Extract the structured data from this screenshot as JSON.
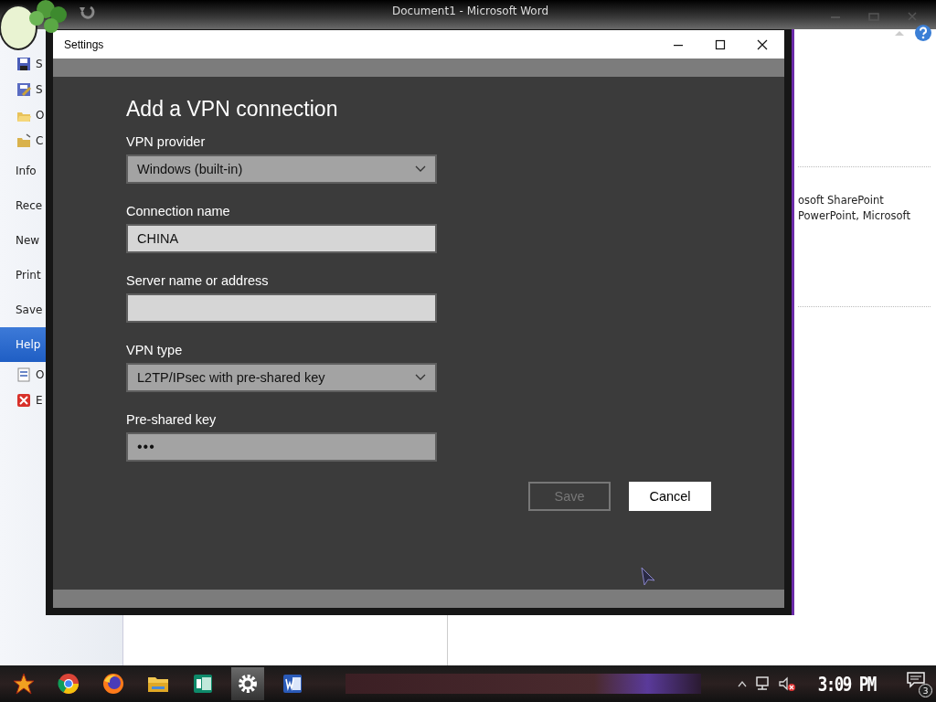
{
  "word_window": {
    "title": "Document1 - Microsoft Word",
    "backstage_items": [
      {
        "label": "S",
        "kind": "command",
        "selected": false
      },
      {
        "label": "S",
        "kind": "command",
        "selected": false
      },
      {
        "label": "O",
        "kind": "command",
        "selected": false
      },
      {
        "label": "C",
        "kind": "command",
        "selected": false
      },
      {
        "label": "Info",
        "kind": "tab",
        "selected": false
      },
      {
        "label": "Rece",
        "kind": "tab",
        "selected": false
      },
      {
        "label": "New",
        "kind": "tab",
        "selected": false
      },
      {
        "label": "Print",
        "kind": "tab",
        "selected": false
      },
      {
        "label": "Save",
        "kind": "tab",
        "selected": false
      },
      {
        "label": "Help",
        "kind": "tab",
        "selected": true
      },
      {
        "label": "O",
        "kind": "command",
        "selected": false
      },
      {
        "label": "E",
        "kind": "command",
        "selected": false
      }
    ],
    "content_lines": [
      "osoft SharePoint",
      "PowerPoint, Microsoft"
    ]
  },
  "dialog": {
    "title": "Settings",
    "heading": "Add a VPN connection",
    "fields": [
      {
        "label": "VPN provider",
        "kind": "dropdown",
        "value": "Windows (built-in)"
      },
      {
        "label": "Connection name",
        "kind": "text",
        "value": "CHINA"
      },
      {
        "label": "Server name or address",
        "kind": "text"
      },
      {
        "label": "VPN type",
        "kind": "dropdown",
        "value": "L2TP/IPsec with pre-shared key"
      },
      {
        "label": "Pre-shared key",
        "kind": "password",
        "value": "•••"
      }
    ],
    "buttons": [
      {
        "label": "Save",
        "disabled": true
      },
      {
        "label": "Cancel",
        "disabled": false
      }
    ]
  },
  "taskbar": {
    "apps": [
      {
        "kind": "launcher",
        "active": false
      },
      {
        "kind": "chrome",
        "active": false
      },
      {
        "kind": "firefox",
        "active": false
      },
      {
        "kind": "folder",
        "active": false
      },
      {
        "kind": "publisher",
        "active": false
      },
      {
        "kind": "settings",
        "active": true
      },
      {
        "kind": "word",
        "active": false
      }
    ],
    "clock": "3:09 PM",
    "notification_count": "3"
  }
}
